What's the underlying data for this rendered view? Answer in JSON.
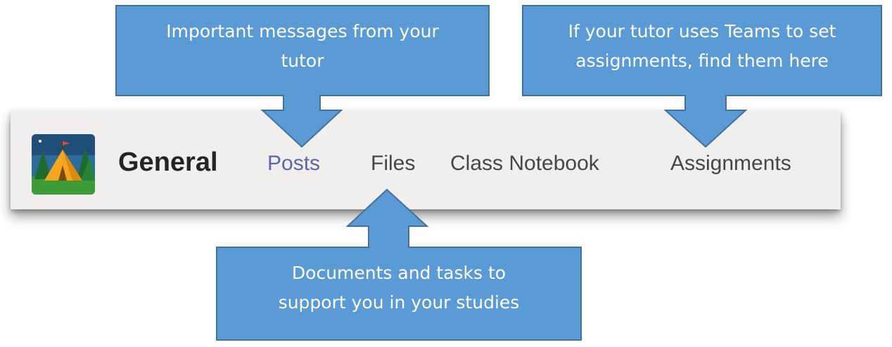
{
  "header": {
    "channel_name": "General",
    "tabs": [
      {
        "label": "Posts",
        "active": true
      },
      {
        "label": "Files",
        "active": false
      },
      {
        "label": "Class Notebook",
        "active": false
      },
      {
        "label": "Assignments",
        "active": false
      }
    ],
    "team_icon": "camping-tent-icon"
  },
  "callouts": {
    "posts": {
      "line1": "Important messages from your",
      "line2": "tutor"
    },
    "assignments": {
      "line1": "If your tutor uses Teams to set",
      "line2": "assignments, find them here"
    },
    "files": {
      "line1": "Documents and tasks to",
      "line2": "support you in your studies"
    }
  },
  "colors": {
    "callout_fill": "#5b9bd5",
    "callout_border": "#41719c",
    "active_tab": "#6264a7",
    "bar_background": "#f0efee"
  }
}
